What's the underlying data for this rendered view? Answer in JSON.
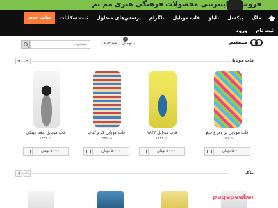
{
  "banner": {
    "text": "فروشگاه اینترنتی محصولات فرهنگی هنری مم تم"
  },
  "nav": {
    "row1": [
      "ماگ",
      "پیکسل",
      "تابلو",
      "قاب موبایل",
      "تلگرام",
      "پرسش‌های متداول",
      "ثبت شکایات",
      "سایت جدید"
    ],
    "row2": [
      "ثبت نام",
      "ورود"
    ],
    "highlight": "سایت جدید"
  },
  "logo": {
    "text": "میمتیم"
  },
  "cart": {
    "amount": "۰ تومان",
    "button": "سبد خرید",
    "count": "۰"
  },
  "search": {
    "placeholder": "جستجو...",
    "button_icon": "search-icon"
  },
  "sections": {
    "phone_cases": {
      "title": "قاب موبایل"
    },
    "mugs": {
      "title": "ماگ"
    }
  },
  "products": [
    {
      "name": "قاب موبایل پر ومرغ جیغ",
      "code": "کد ۱۶۹۵",
      "price": "۵۰۰۰۰ تومان"
    },
    {
      "name": "قاب موبایل ۱۸۴۳",
      "code": "کد ۱۸۴۳",
      "price": "۵۰۰۰۰ تومان"
    },
    {
      "name": "قاب موبایل کرم کتاب",
      "code": "کد ۱۳۳۶",
      "price": "۵۰۰۰۰ تومان"
    },
    {
      "name": "قاب موبایل جغد عینکی",
      "code": "کد ۱۳۴۳",
      "price": "۵۰۰۰۰ تومان"
    }
  ],
  "watermark": "pagepeeker",
  "colors": {
    "banner": "#7ec14b",
    "nav": "#0f0f0f",
    "highlight": "#ff7a3a",
    "watermark": "#f23f63"
  }
}
